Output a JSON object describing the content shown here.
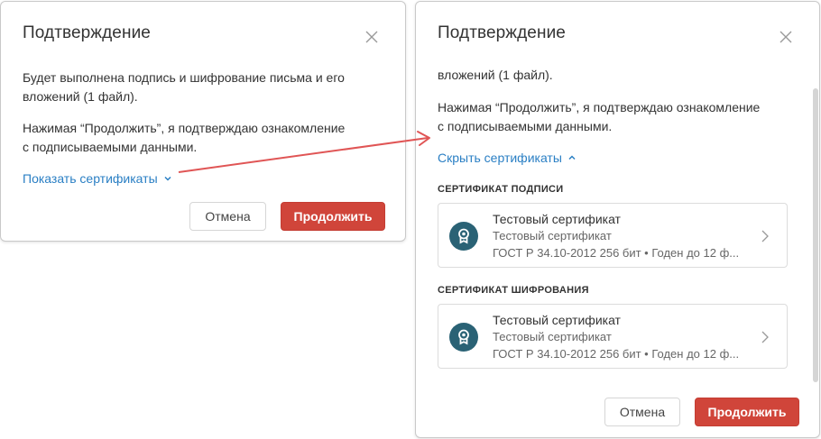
{
  "left_dialog": {
    "title": "Подтверждение",
    "line1": "Будет выполнена подпись и шифрование письма и его",
    "line2": "вложений (1 файл).",
    "line3": "Нажимая “Продолжить”, я подтверждаю ознакомление",
    "line4": "с подписываемыми данными.",
    "toggle_link": "Показать сертификаты",
    "cancel_label": "Отмена",
    "continue_label": "Продолжить"
  },
  "right_dialog": {
    "title": "Подтверждение",
    "line_top": "вложений (1 файл).",
    "line3": "Нажимая “Продолжить”, я подтверждаю ознакомление",
    "line4": "с подписываемыми данными.",
    "toggle_link": "Скрыть сертификаты",
    "sections": [
      {
        "label": "СЕРТИФИКАТ ПОДПИСИ",
        "cert": {
          "name": "Тестовый сертификат",
          "subtitle": "Тестовый сертификат",
          "meta": "ГОСТ Р 34.10-2012 256 бит • Годен до 12 ф..."
        }
      },
      {
        "label": "СЕРТИФИКАТ ШИФРОВАНИЯ",
        "cert": {
          "name": "Тестовый сертификат",
          "subtitle": "Тестовый сертификат",
          "meta": "ГОСТ Р 34.10-2012 256 бит • Годен до 12 ф..."
        }
      }
    ],
    "cancel_label": "Отмена",
    "continue_label": "Продолжить"
  },
  "colors": {
    "link": "#2a7fc4",
    "primary_button": "#d0453a",
    "cert_icon_bg": "#2a6275",
    "annotation_arrow": "#e05555"
  },
  "icons": {
    "close": "close-icon",
    "chevron_down": "chevron-down-icon",
    "chevron_up": "chevron-up-icon",
    "chevron_right": "chevron-right-icon",
    "certificate": "certificate-icon"
  }
}
